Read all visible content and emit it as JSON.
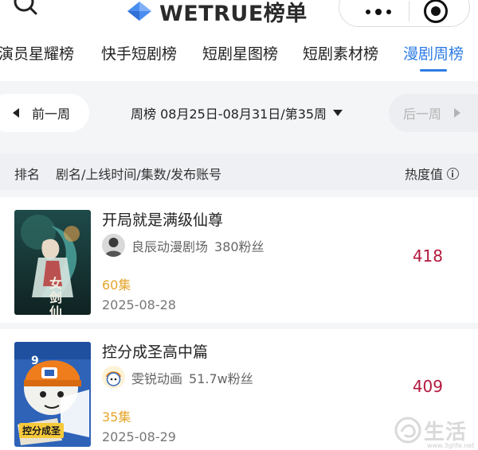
{
  "header": {
    "brand_name": "WETRUE榜单",
    "icons": [
      "search-icon",
      "logo-icon",
      "more-icon",
      "close-icon"
    ]
  },
  "tabs": [
    {
      "label": "演员星耀榜",
      "active": false
    },
    {
      "label": "快手短剧榜",
      "active": false
    },
    {
      "label": "短剧星图榜",
      "active": false
    },
    {
      "label": "短剧素材榜",
      "active": false
    },
    {
      "label": "漫剧周榜",
      "active": true
    }
  ],
  "week": {
    "prev_label": "前一周",
    "current": "周榜 08月25日-08月31日/第35周",
    "next_label": "后一周"
  },
  "columns": {
    "rank": "排名",
    "info": "剧名/上线时间/集数/发布账号",
    "heat": "热度值"
  },
  "items": [
    {
      "rank": "",
      "poster_text": "女剑仙",
      "title": "开局就是满级仙尊",
      "account": "良辰动漫剧场",
      "followers": "380粉丝",
      "episodes": "60集",
      "date": "2025-08-28",
      "heat": "418"
    },
    {
      "rank": "9",
      "poster_text": "控分成圣",
      "title": "控分成圣高中篇",
      "account": "雯锐动画",
      "followers": "51.7w粉丝",
      "episodes": "35集",
      "date": "2025-08-29",
      "heat": "409"
    }
  ],
  "watermark": {
    "text": "生活",
    "url": "www.3glife.net"
  },
  "colors": {
    "accent": "#2d7be5",
    "heat": "#b3193e",
    "episodes": "#e5a52a"
  }
}
